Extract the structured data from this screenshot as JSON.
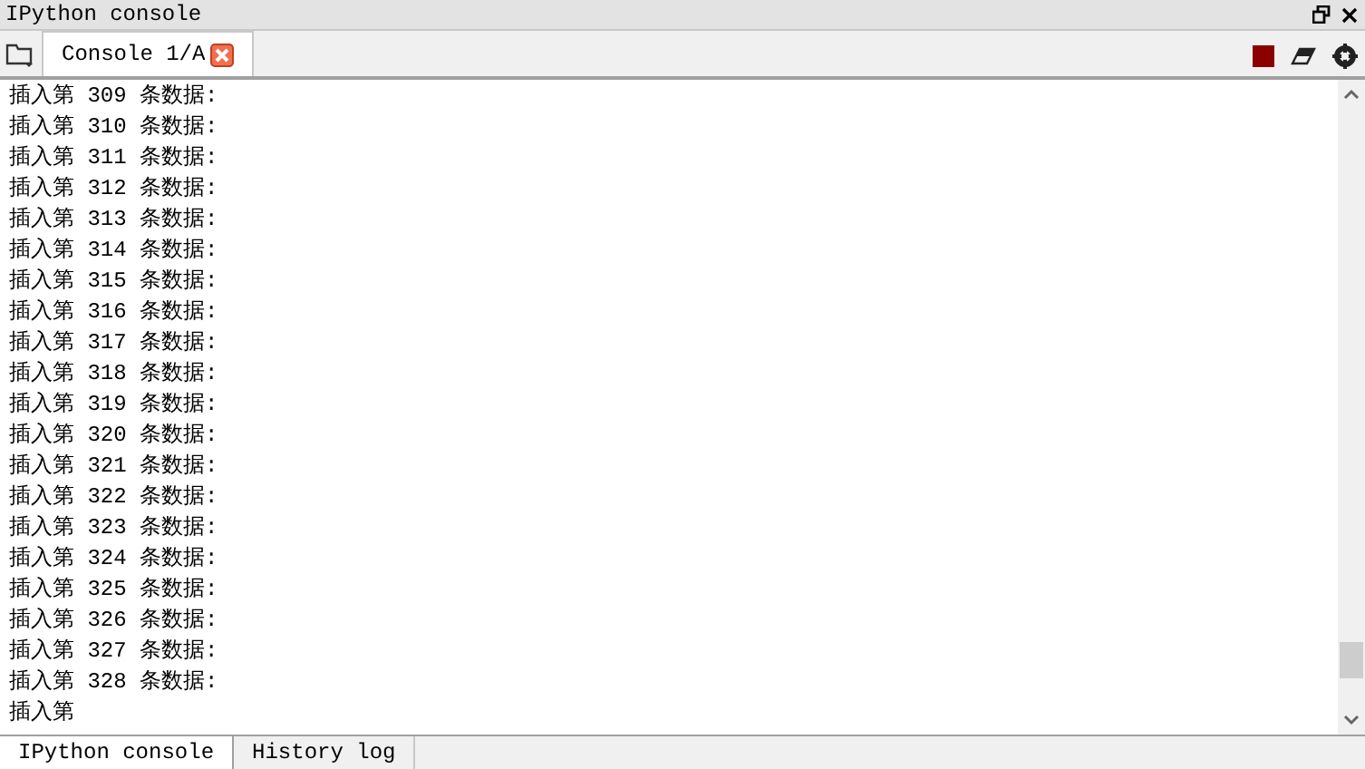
{
  "pane_title": "IPython console",
  "console_tabs": [
    {
      "label": "Console 1/A",
      "selected": true
    }
  ],
  "output_lines": [
    "插入第 309 条数据:",
    "插入第 310 条数据:",
    "插入第 311 条数据:",
    "插入第 312 条数据:",
    "插入第 313 条数据:",
    "插入第 314 条数据:",
    "插入第 315 条数据:",
    "插入第 316 条数据:",
    "插入第 317 条数据:",
    "插入第 318 条数据:",
    "插入第 319 条数据:",
    "插入第 320 条数据:",
    "插入第 321 条数据:",
    "插入第 322 条数据:",
    "插入第 323 条数据:",
    "插入第 324 条数据:",
    "插入第 325 条数据:",
    "插入第 326 条数据:",
    "插入第 327 条数据:",
    "插入第 328 条数据:",
    "插入第"
  ],
  "bottom_tabs": [
    {
      "label": "IPython console",
      "selected": true
    },
    {
      "label": "History log",
      "selected": false
    }
  ]
}
